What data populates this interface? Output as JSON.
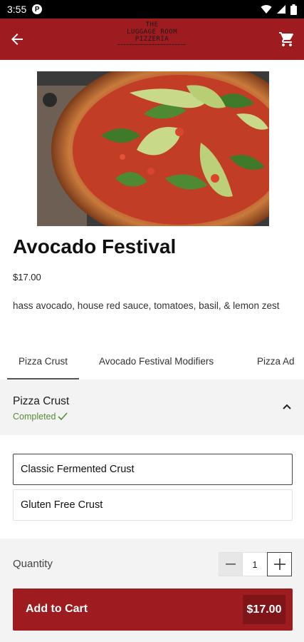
{
  "status_bar": {
    "time": "3:55",
    "badge": "P"
  },
  "app_bar": {
    "logo_line1": "THE",
    "logo_line2": "LUGGAGE ROOM",
    "logo_line3": "PIZZERIA",
    "back_icon": "arrow-left-icon",
    "cart_icon": "cart-icon",
    "accent_color": "#9e1b20"
  },
  "product": {
    "title": "Avocado Festival",
    "price": "$17.00",
    "description": "hass avocado, house red sauce, tomatoes, basil, & lemon zest"
  },
  "tabs": [
    {
      "label": "Pizza Crust",
      "active": true
    },
    {
      "label": "Avocado Festival Modifiers",
      "active": false
    },
    {
      "label": "Pizza Ad",
      "active": false
    }
  ],
  "section": {
    "title": "Pizza Crust",
    "status": "Completed",
    "status_icon": "check-icon",
    "collapse_icon": "chevron-up-icon"
  },
  "options": [
    {
      "label": "Classic Fermented Crust",
      "selected": true
    },
    {
      "label": "Gluten Free Crust",
      "selected": false
    }
  ],
  "quantity": {
    "label": "Quantity",
    "value": "1"
  },
  "cart_button": {
    "label": "Add to Cart",
    "total": "$17.00"
  }
}
